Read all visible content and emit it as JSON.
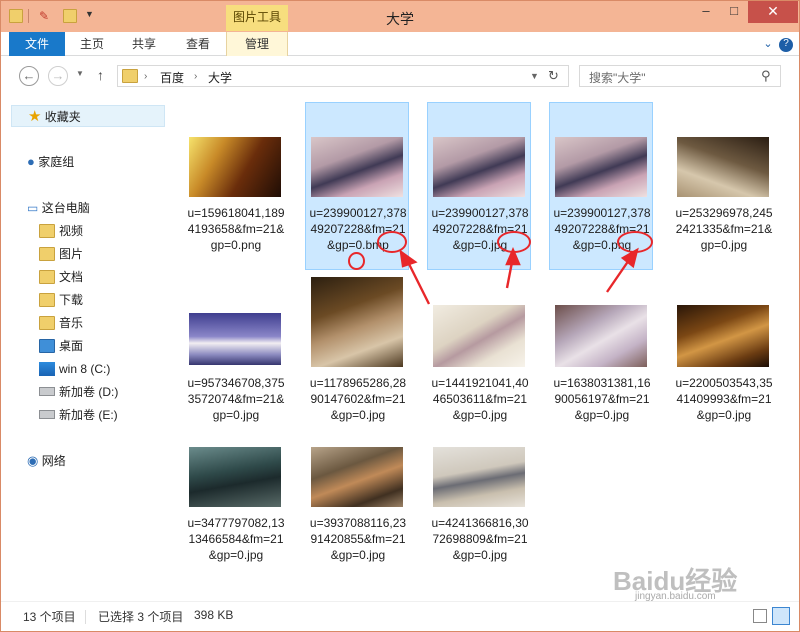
{
  "window": {
    "title": "大学",
    "context_tab": "图片工具",
    "caption_buttons": [
      "–",
      "□",
      "✕"
    ]
  },
  "ribbon": {
    "tabs": [
      "文件",
      "主页",
      "共享",
      "查看",
      "管理"
    ]
  },
  "address": {
    "path": [
      "百度",
      "大学"
    ],
    "search_placeholder": "搜索\"大学\""
  },
  "navigation": {
    "favorites": "收藏夹",
    "homegroup": "家庭组",
    "this_pc": "这台电脑",
    "items": [
      "视频",
      "图片",
      "文档",
      "下载",
      "音乐",
      "桌面"
    ],
    "drives": [
      "win 8 (C:)",
      "新加卷 (D:)",
      "新加卷 (E:)"
    ],
    "network": "网络"
  },
  "files": [
    {
      "name": "u=159618041,1894193658&fm=21&gp=0.png",
      "selected": false
    },
    {
      "name": "u=239900127,37849207228&fm=21&gp=0.bmp",
      "selected": true
    },
    {
      "name": "u=239900127,37849207228&fm=21&gp=0.jpg",
      "selected": true
    },
    {
      "name": "u=239900127,37849207228&fm=21&gp=0.png",
      "selected": true
    },
    {
      "name": "u=253296978,2452421335&fm=21&gp=0.jpg",
      "selected": false
    },
    {
      "name": "u=957346708,3753572074&fm=21&gp=0.jpg",
      "selected": false
    },
    {
      "name": "u=1178965286,2890147602&fm=21&gp=0.jpg",
      "selected": false
    },
    {
      "name": "u=1441921041,4046503611&fm=21&gp=0.jpg",
      "selected": false
    },
    {
      "name": "u=1638031381,1690056197&fm=21&gp=0.jpg",
      "selected": false
    },
    {
      "name": "u=2200503543,3541409993&fm=21&gp=0.jpg",
      "selected": false
    },
    {
      "name": "u=3477797082,1313466584&fm=21&gp=0.jpg",
      "selected": false
    },
    {
      "name": "u=3937088116,2391420855&fm=21&gp=0.jpg",
      "selected": false
    },
    {
      "name": "u=4241366816,3072698809&fm=21&gp=0.jpg",
      "selected": false
    }
  ],
  "status": {
    "item_count": "13 个项目",
    "selection": "已选择 3 个项目",
    "size": "398 KB"
  },
  "watermark": {
    "brand": "Baidu经验",
    "url": "jingyan.baidu.com"
  },
  "colors": {
    "titlebar": "#f4b595",
    "file_tab": "#1979ca",
    "selection_bg": "#cce8ff",
    "selection_border": "#99d1ff",
    "annotation": "#e8272a"
  }
}
